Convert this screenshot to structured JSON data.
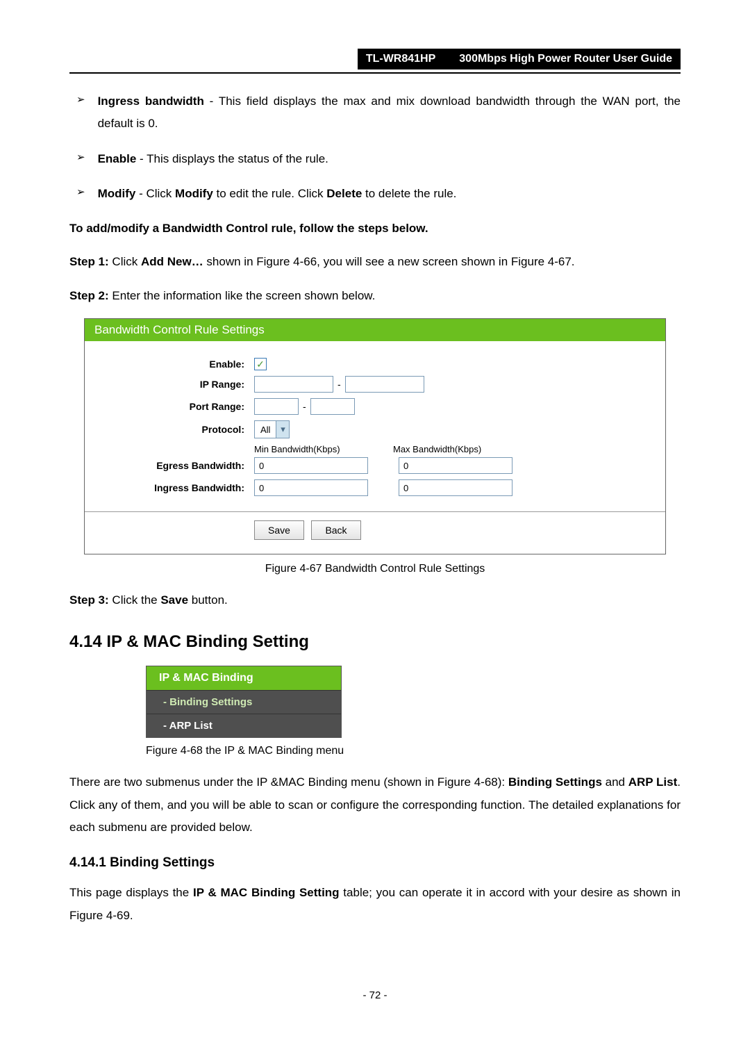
{
  "header": {
    "model": "TL-WR841HP",
    "title": "300Mbps High Power Router User Guide"
  },
  "bullets": [
    {
      "term": "Ingress bandwidth",
      "rest": " - This field displays the max and mix download bandwidth through the WAN port, the default is 0."
    },
    {
      "term": "Enable",
      "rest": " - This displays the status of the rule."
    }
  ],
  "modify_bullet": {
    "term": "Modify",
    "pre": " - Click ",
    "b1": "Modify",
    "mid": " to edit the rule. Click ",
    "b2": "Delete",
    "post": " to delete the rule."
  },
  "add_heading": "To add/modify a Bandwidth Control rule, follow the steps below.",
  "step1": {
    "label": "Step 1:",
    "pre": "  Click ",
    "b": "Add New…",
    "post": " shown in Figure 4-66, you will see a new screen shown in Figure 4-67."
  },
  "step2": {
    "label": "Step 2:",
    "rest": "  Enter the information like the screen shown below."
  },
  "panel": {
    "title": "Bandwidth Control Rule Settings",
    "labels": {
      "enable": "Enable:",
      "ip_range": "IP Range:",
      "port_range": "Port Range:",
      "protocol": "Protocol:",
      "egress": "Egress Bandwidth:",
      "ingress": "Ingress Bandwidth:"
    },
    "protocol_value": "All",
    "bw_headers": {
      "min": "Min Bandwidth(Kbps)",
      "max": "Max Bandwidth(Kbps)"
    },
    "egress_min": "0",
    "egress_max": "0",
    "ingress_min": "0",
    "ingress_max": "0",
    "buttons": {
      "save": "Save",
      "back": "Back"
    }
  },
  "fig67_caption": "Figure 4-67 Bandwidth Control Rule Settings",
  "step3": {
    "label": "Step 3:",
    "pre": "  Click the ",
    "b": "Save",
    "post": " button."
  },
  "section_heading": "4.14  IP & MAC Binding Setting",
  "menu": {
    "header": "IP & MAC Binding",
    "item1": "- Binding Settings",
    "item2": "- ARP List"
  },
  "fig68_caption": "Figure 4-68 the IP & MAC Binding menu",
  "para_binding": {
    "p1": "There are two submenus under the IP &MAC Binding menu (shown in Figure 4-68): ",
    "b1": "Binding Settings",
    "p2": " and ",
    "b2": "ARP List",
    "p3": ". Click any of them, and you will be able to scan or configure the corresponding function. The detailed explanations for each submenu are provided below."
  },
  "subsection_heading": "4.14.1 Binding Settings",
  "para_bsettings": {
    "p1": "This page displays the ",
    "b1": "IP & MAC Binding Setting",
    "p2": " table; you can operate it in accord with your desire as shown in Figure 4-69."
  },
  "page_number": "- 72 -"
}
